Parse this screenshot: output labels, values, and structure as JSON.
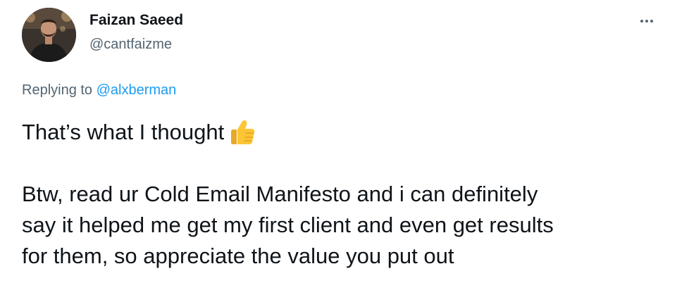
{
  "author": {
    "display_name": "Faizan Saeed",
    "handle": "@cantfaizme"
  },
  "more_menu_icon": "ellipsis-icon",
  "replying_to": {
    "prefix": "Replying to",
    "target": "@alxberman"
  },
  "tweet": {
    "line1_text": "That’s what I thought",
    "line1_emoji": "thumbs-up-emoji",
    "para2_lines": [
      "Btw, read ur Cold Email Manifesto and i can definitely",
      "say it helped me get my first client and even get results",
      "for them, so appreciate the value you put out"
    ]
  },
  "colors": {
    "text_primary": "#0f1419",
    "text_secondary": "#536471",
    "link": "#1d9bf0",
    "background": "#ffffff"
  }
}
